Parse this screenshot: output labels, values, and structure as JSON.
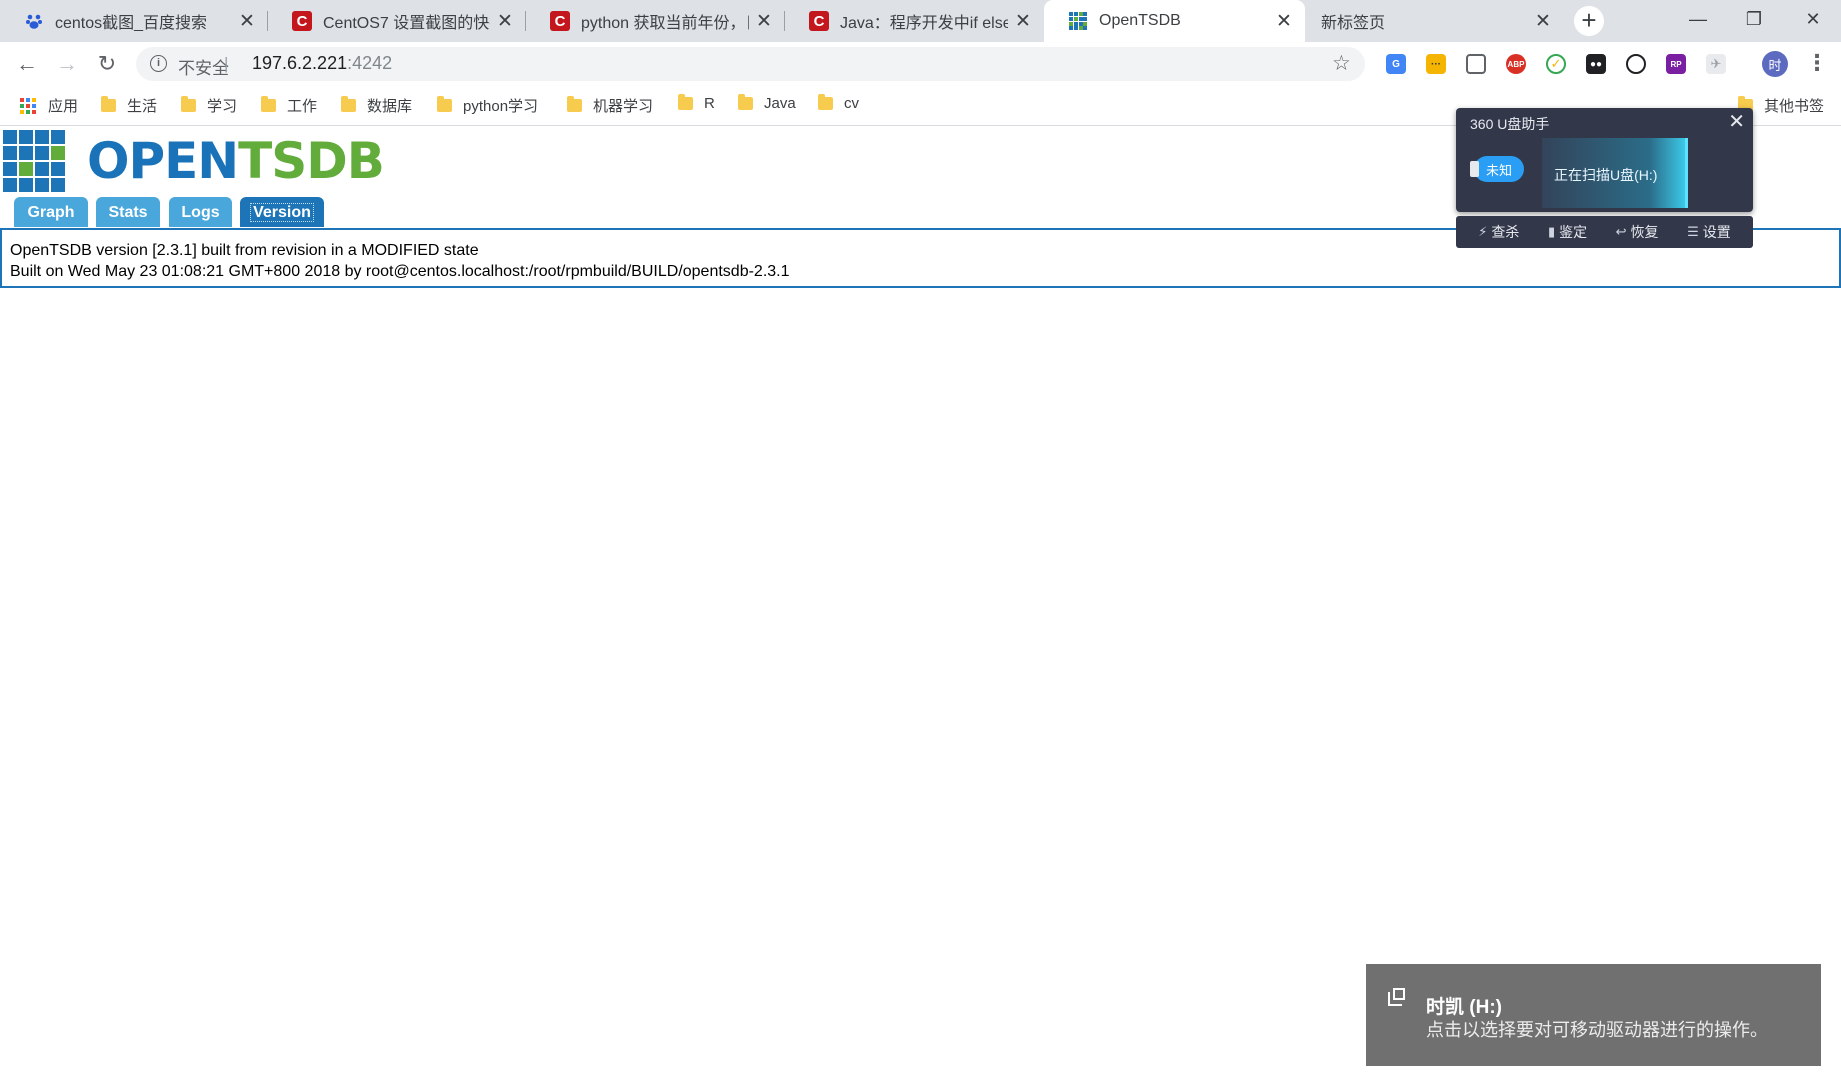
{
  "tabs": [
    {
      "title": "centos截图_百度搜索",
      "icon": "baidu-paw-icon",
      "active": false
    },
    {
      "title": "CentOS7 设置截图的快捷",
      "icon": "csdn-icon",
      "active": false
    },
    {
      "title": "python 获取当前年份，日",
      "icon": "csdn-icon",
      "active": false
    },
    {
      "title": "Java：程序开发中if else多",
      "icon": "csdn-icon",
      "active": false
    },
    {
      "title": "OpenTSDB",
      "icon": "opentsdb-favicon",
      "active": true
    },
    {
      "title": "新标签页",
      "icon": "",
      "active": false
    }
  ],
  "toolbar": {
    "insecure_label": "不安全",
    "url_host": "197.6.2.221",
    "url_port": ":4242"
  },
  "bookmarks": [
    {
      "label": "应用",
      "type": "apps"
    },
    {
      "label": "生活",
      "type": "folder"
    },
    {
      "label": "学习",
      "type": "folder"
    },
    {
      "label": "工作",
      "type": "folder"
    },
    {
      "label": "数据库",
      "type": "folder"
    },
    {
      "label": "python学习",
      "type": "folder"
    },
    {
      "label": "机器学习",
      "type": "folder"
    },
    {
      "label": "R",
      "type": "folder"
    },
    {
      "label": "Java",
      "type": "folder"
    },
    {
      "label": "cv",
      "type": "folder"
    }
  ],
  "other_bookmarks": "其他书签",
  "profile_initial": "时",
  "logo": {
    "part1": "OPEN",
    "part2": "TSDB"
  },
  "nav_tabs": [
    {
      "label": "Graph",
      "active": false
    },
    {
      "label": "Stats",
      "active": false
    },
    {
      "label": "Logs",
      "active": false
    },
    {
      "label": "Version",
      "active": true
    }
  ],
  "version": {
    "line1": "OpenTSDB version [2.3.1] built from revision  in a MODIFIED state",
    "line2": "Built on Wed May 23 01:08:21 GMT+800 2018 by root@centos.localhost:/root/rpmbuild/BUILD/opentsdb-2.3.1"
  },
  "usb_helper": {
    "title": "360 U盘助手",
    "badge": "未知",
    "status": "正在扫描U盘(H:)",
    "actions": [
      {
        "label": "查杀",
        "icon": "lightning-icon"
      },
      {
        "label": "鉴定",
        "icon": "usb-drive-icon"
      },
      {
        "label": "恢复",
        "icon": "restore-arrow-icon"
      },
      {
        "label": "设置",
        "icon": "list-icon"
      }
    ]
  },
  "toast": {
    "title": "时凯 (H:)",
    "body": "点击以选择要对可移动驱动器进行的操作。"
  },
  "colors": {
    "brand_blue": "#1d75b8",
    "tab_blue": "#4aa7db",
    "brand_green": "#62ac3b",
    "chrome_frame": "#dee1e6"
  }
}
